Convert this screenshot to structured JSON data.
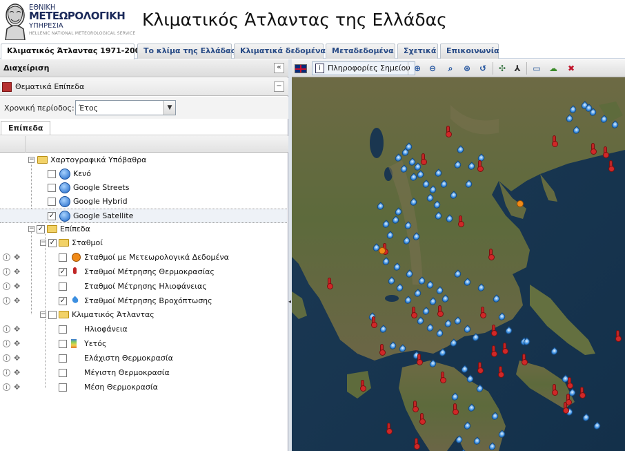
{
  "header": {
    "logo_line1": "ΕΘΝΙΚΗ",
    "logo_line2": "ΜΕΤΕΩΡΟΛΟΓΙΚΗ",
    "logo_line3": "ΥΠΗΡΕΣΙΑ",
    "logo_line4": "HELLENIC NATIONAL METEOROLOGICAL SERVICE",
    "title": "Κλιματικός Άτλαντας της Ελλάδας"
  },
  "tabs": [
    {
      "label": "Κλιματικός Άτλαντας 1971-2000",
      "active": true
    },
    {
      "label": "Το κλίμα της Ελλάδας",
      "active": false
    },
    {
      "label": "Κλιματικά δεδομένα",
      "active": false
    },
    {
      "label": "Μεταδεδομένα",
      "active": false
    },
    {
      "label": "Σχετικά",
      "active": false
    },
    {
      "label": "Επικοινωνία",
      "active": false
    }
  ],
  "left_panel": {
    "title": "Διαχείριση",
    "collapse_glyph": "«",
    "thematic_title": "Θεματικά Επίπεδα",
    "thematic_toggle": "−",
    "period_label": "Χρονική περίοδος:",
    "period_value": "Έτος",
    "layers_tab": "Επίπεδα"
  },
  "tree": {
    "basemaps": {
      "label": "Χαρτογραφικά Υπόβαθρα",
      "items": [
        {
          "label": "Κενό",
          "checked": false
        },
        {
          "label": "Google Streets",
          "checked": false
        },
        {
          "label": "Google Hybrid",
          "checked": false
        },
        {
          "label": "Google Satellite",
          "checked": true
        }
      ]
    },
    "layers": {
      "label": "Επίπεδα",
      "checked": true
    },
    "stations": {
      "label": "Σταθμοί",
      "checked": true,
      "items": [
        {
          "label": "Σταθμοί με Μετεωρολογικά Δεδομένα",
          "checked": false,
          "icon": "meteo-station-icon"
        },
        {
          "label": "Σταθμοί Μέτρησης Θερμοκρασίας",
          "checked": true,
          "icon": "thermometer-icon"
        },
        {
          "label": "Σταθμοί Μέτρησης Ηλιοφάνειας",
          "checked": false,
          "icon": ""
        },
        {
          "label": "Σταθμοί Μέτρησης Βροχόπτωσης",
          "checked": true,
          "icon": "raindrop-icon"
        }
      ]
    },
    "atlas": {
      "label": "Κλιματικός Άτλαντας",
      "checked": false,
      "items": [
        {
          "label": "Ηλιοφάνεια",
          "checked": false
        },
        {
          "label": "Υετός",
          "checked": false
        },
        {
          "label": "Ελάχιστη Θερμοκρασία",
          "checked": false
        },
        {
          "label": "Μέγιστη Θερμοκρασία",
          "checked": false
        },
        {
          "label": "Μέση Θερμοκρασία",
          "checked": false
        }
      ]
    }
  },
  "map_toolbar": {
    "point_info": "Πληροφορίες Σημείου",
    "tools": [
      "zoom-in-icon",
      "zoom-out-icon",
      "zoom-box-icon",
      "zoom-extent-icon",
      "zoom-previous-icon",
      "pan-icon",
      "measure-icon",
      "area-icon",
      "legend-icon",
      "clear-icon"
    ]
  },
  "colors": {
    "tab_text": "#274a85",
    "rain_marker": "#3c8fe0",
    "temp_marker": "#c02525",
    "meteo_marker": "#f08a18"
  }
}
